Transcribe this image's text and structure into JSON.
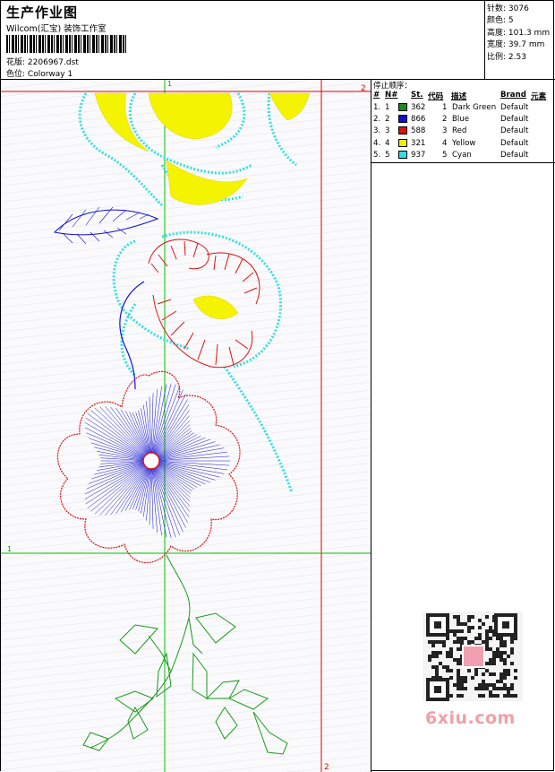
{
  "header": {
    "title": "生产作业图",
    "subtitle": "Wilcom(汇宝) 装饰工作室",
    "design_label": "花版:",
    "design_file": "2206967.dst",
    "colorway_label": "色位:",
    "colorway": "Colorway 1"
  },
  "specs": [
    {
      "label": "针数:",
      "value": "3076"
    },
    {
      "label": "颜色:",
      "value": "5"
    },
    {
      "label": "高度:",
      "value": "101.3 mm"
    },
    {
      "label": "宽度:",
      "value": "39.7 mm"
    },
    {
      "label": "比例:",
      "value": "2.53"
    }
  ],
  "stop_sequence": {
    "title": "停止顺序：",
    "columns": {
      "hash": "#",
      "no": "N#",
      "stitches": "St.",
      "code": "代码",
      "desc": "描述",
      "brand": "Brand",
      "element": "元素"
    },
    "rows": [
      {
        "idx": "1.",
        "no": "1",
        "color": "#1a8a1a",
        "stitches": "362",
        "code": "1",
        "desc": "Dark Green",
        "brand": "Default"
      },
      {
        "idx": "2.",
        "no": "2",
        "color": "#1010d0",
        "stitches": "866",
        "code": "2",
        "desc": "Blue",
        "brand": "Default"
      },
      {
        "idx": "3.",
        "no": "3",
        "color": "#e01010",
        "stitches": "588",
        "code": "3",
        "desc": "Red",
        "brand": "Default"
      },
      {
        "idx": "4.",
        "no": "4",
        "color": "#f0f000",
        "stitches": "321",
        "code": "4",
        "desc": "Yellow",
        "brand": "Default"
      },
      {
        "idx": "5.",
        "no": "5",
        "color": "#30e0e0",
        "stitches": "937",
        "code": "5",
        "desc": "Cyan",
        "brand": "Default"
      }
    ]
  },
  "guides": {
    "top_1": "1",
    "top_2": "2",
    "left_1": "1",
    "bottom_2": "2"
  },
  "watermark": "6xiu.com",
  "colors": {
    "guide_green": "#00c000",
    "guide_red": "#e00000"
  }
}
